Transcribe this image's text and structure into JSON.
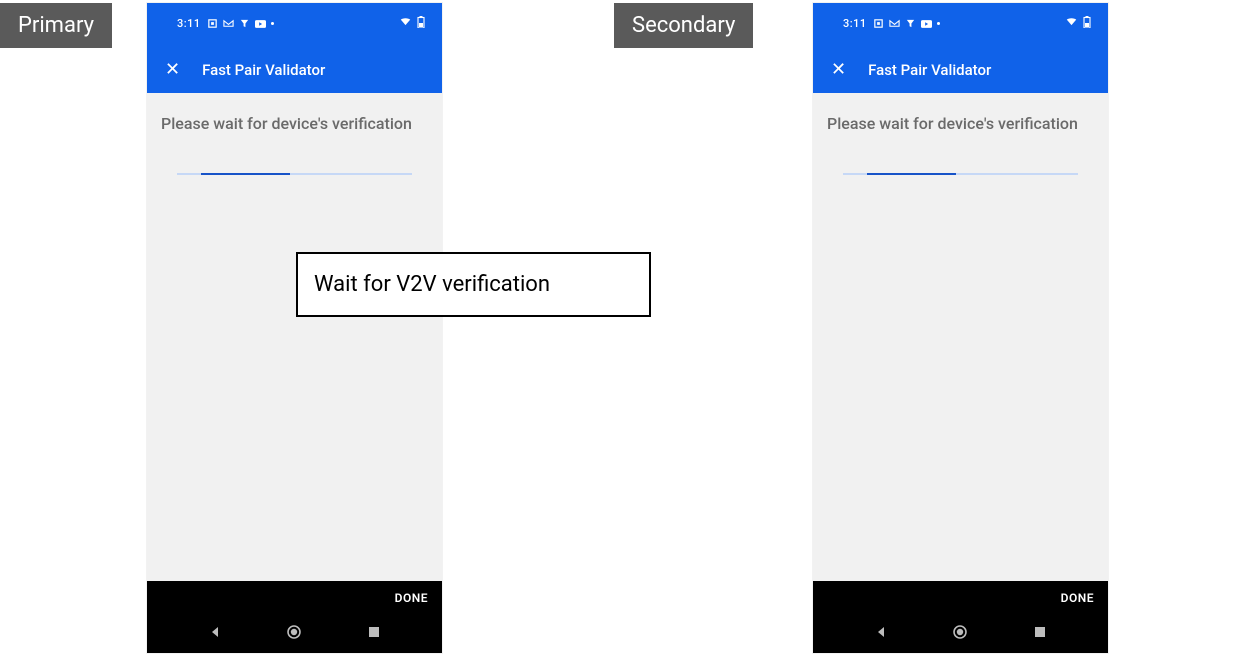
{
  "labels": {
    "primary": "Primary",
    "secondary": "Secondary"
  },
  "callout": "Wait for V2V verification",
  "phone_primary": {
    "status": {
      "time": "3:11"
    },
    "appbar": {
      "title": "Fast Pair Validator"
    },
    "content": {
      "wait_text": "Please wait for device's verification"
    },
    "footer": {
      "done": "DONE"
    }
  },
  "phone_secondary": {
    "status": {
      "time": "3:11"
    },
    "appbar": {
      "title": "Fast Pair Validator"
    },
    "content": {
      "wait_text": "Please wait for device's verification"
    },
    "footer": {
      "done": "DONE"
    }
  }
}
